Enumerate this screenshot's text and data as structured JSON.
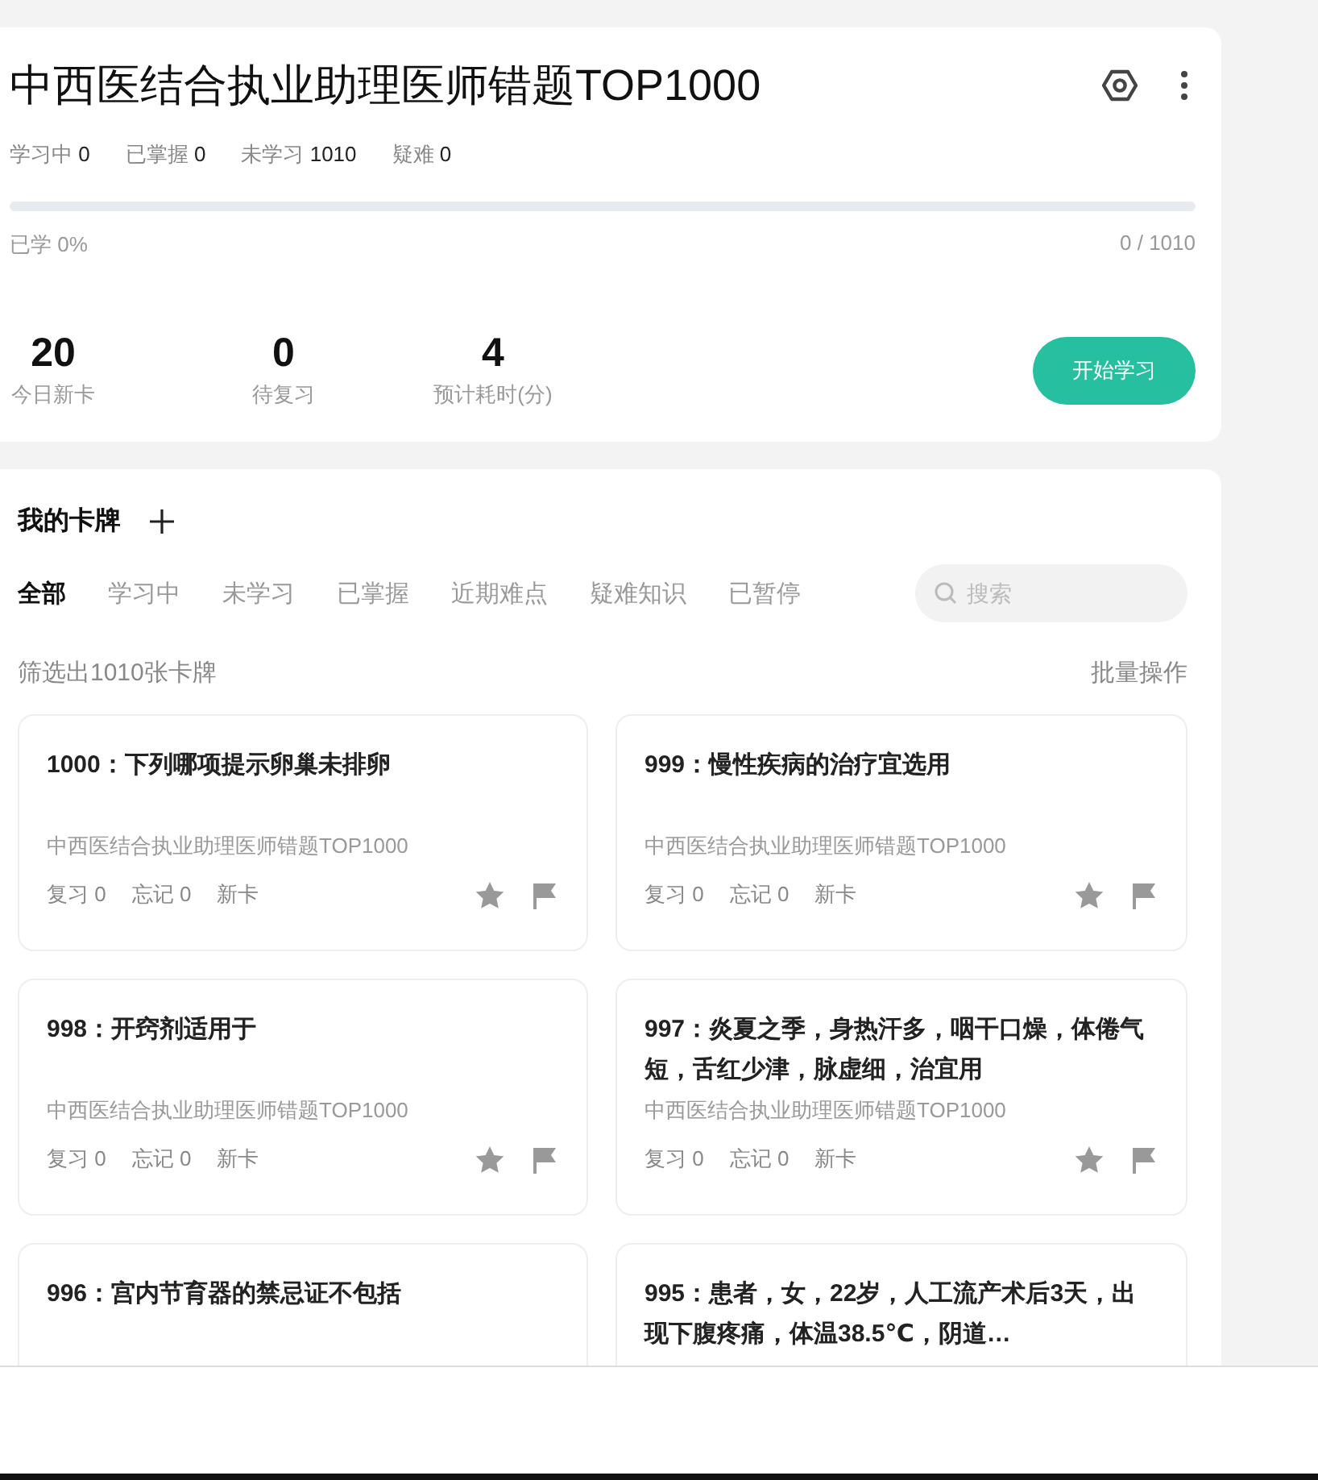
{
  "deck": {
    "title": "中西医结合执业助理医师错题TOP1000",
    "counts": [
      {
        "label": "学习中",
        "value": "0"
      },
      {
        "label": "已掌握",
        "value": "0"
      },
      {
        "label": "未学习",
        "value": "1010"
      },
      {
        "label": "疑难",
        "value": "0"
      }
    ],
    "progress": {
      "level": 0,
      "label": "已学 0%",
      "reading": "0 / 1010"
    },
    "stats": [
      {
        "value": "20",
        "label": "今日新卡"
      },
      {
        "value": "0",
        "label": "待复习"
      },
      {
        "value": "4",
        "label": "预计耗时(分)"
      }
    ],
    "start_button": "开始学习"
  },
  "cards_panel": {
    "title": "我的卡牌",
    "tabs": [
      {
        "label": "全部",
        "selected": true
      },
      {
        "label": "学习中",
        "selected": false
      },
      {
        "label": "未学习",
        "selected": false
      },
      {
        "label": "已掌握",
        "selected": false
      },
      {
        "label": "近期难点",
        "selected": false
      },
      {
        "label": "疑难知识",
        "selected": false
      },
      {
        "label": "已暂停",
        "selected": false
      }
    ],
    "search": {
      "placeholder": "搜索"
    },
    "filter_summary": "筛选出1010张卡牌",
    "batch_action": "批量操作",
    "cards": [
      {
        "title": "1000：下列哪项提示卵巢未排卵",
        "deck": "中西医结合执业助理医师错题TOP1000",
        "review": "复习 0",
        "forget": "忘记 0",
        "status": "新卡"
      },
      {
        "title": "999：慢性疾病的治疗宜选用",
        "deck": "中西医结合执业助理医师错题TOP1000",
        "review": "复习 0",
        "forget": "忘记 0",
        "status": "新卡"
      },
      {
        "title": "998：开窍剂适用于",
        "deck": "中西医结合执业助理医师错题TOP1000",
        "review": "复习 0",
        "forget": "忘记 0",
        "status": "新卡"
      },
      {
        "title": "997：炎夏之季，身热汗多，咽干口燥，体倦气短，舌红少津，脉虚细，治宜用",
        "deck": "中西医结合执业助理医师错题TOP1000",
        "review": "复习 0",
        "forget": "忘记 0",
        "status": "新卡"
      },
      {
        "title": "996：宫内节育器的禁忌证不包括"
      },
      {
        "title": "995：患者，女，22岁，人工流产术后3天，出现下腹疼痛，体温38.5℃，阴道…"
      }
    ]
  }
}
